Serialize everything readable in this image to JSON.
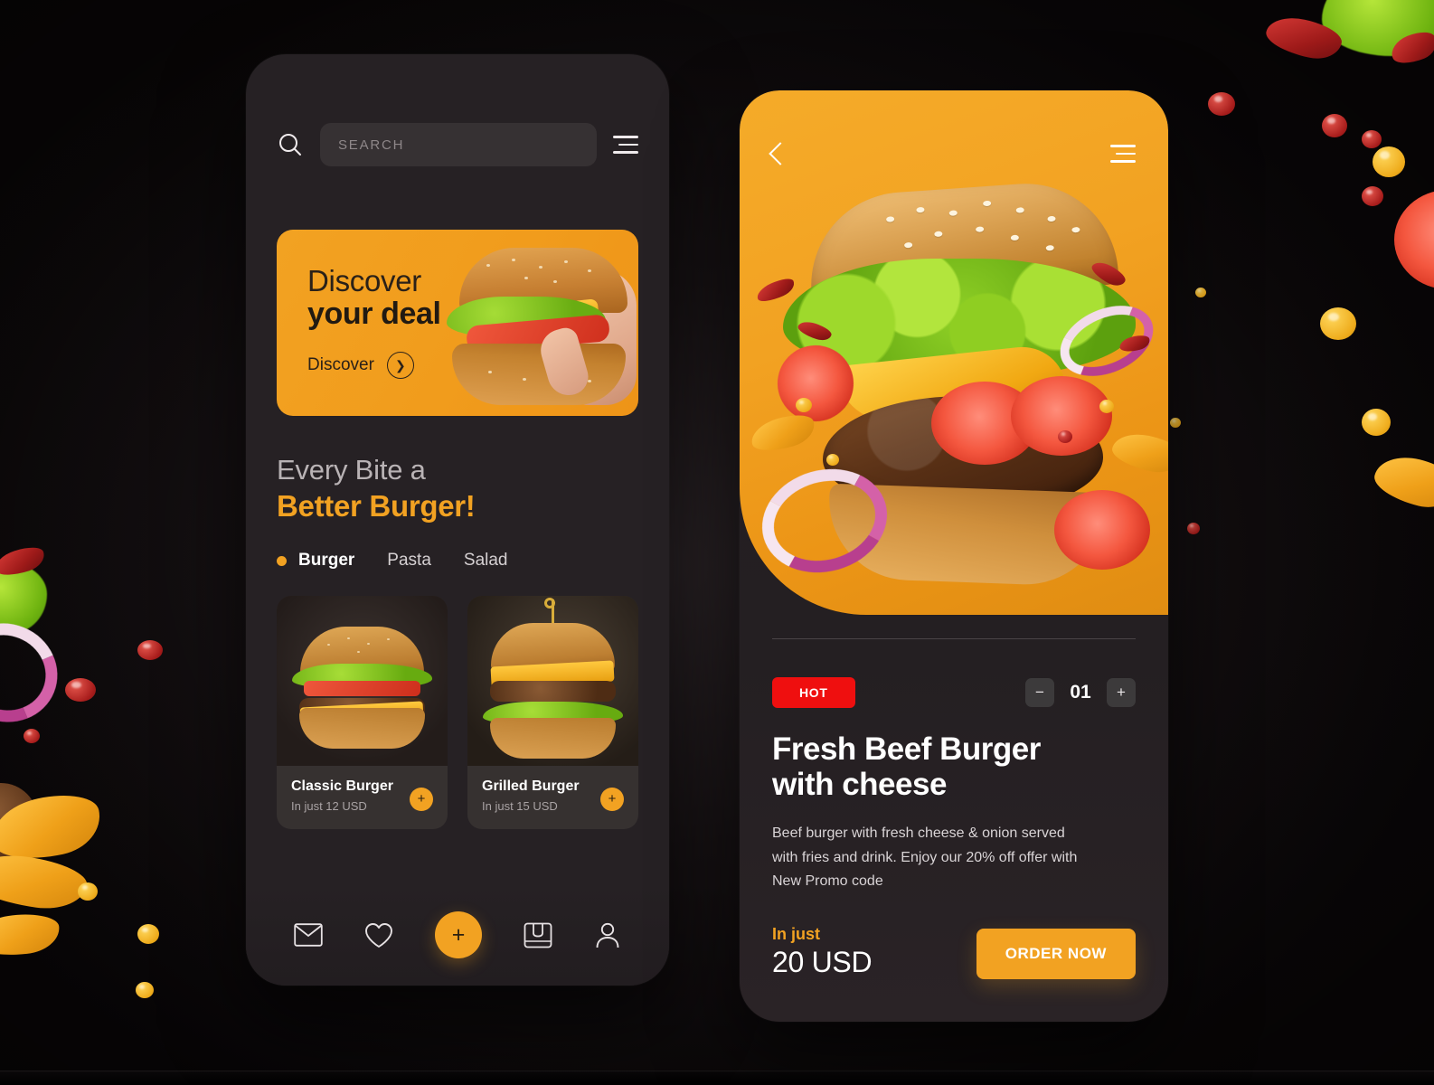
{
  "theme": {
    "accent": "#F2A222",
    "hot": "#EF0F0F",
    "phone_bg": "#262124",
    "card_bg": "#363130",
    "text_primary": "#FFFFFF",
    "text_muted": "#A9A3A4"
  },
  "home": {
    "search": {
      "placeholder": "SEARCH",
      "value": "",
      "icon": "search-icon"
    },
    "menu_icon": "hamburger-menu-icon",
    "promo": {
      "line1": "Discover",
      "line2": "your deal",
      "cta_label": "Discover",
      "cta_icon": "chevron-right-icon"
    },
    "section": {
      "line1": "Every Bite a",
      "line2": "Better Burger!"
    },
    "tabs": [
      {
        "label": "Burger",
        "active": true
      },
      {
        "label": "Pasta",
        "active": false
      },
      {
        "label": "Salad",
        "active": false
      }
    ],
    "products": [
      {
        "name": "Classic Burger",
        "price": "In just 12 USD",
        "add_label": "+"
      },
      {
        "name": "Grilled Burger",
        "price": "In just 15 USD",
        "add_label": "+"
      }
    ],
    "nav": [
      {
        "name": "mail-icon"
      },
      {
        "name": "heart-icon"
      },
      {
        "name": "add-icon",
        "label": "+"
      },
      {
        "name": "orders-box-icon"
      },
      {
        "name": "profile-person-icon"
      }
    ]
  },
  "detail": {
    "back_icon": "back-chevron-icon",
    "menu_icon": "hamburger-menu-icon",
    "badge": "HOT",
    "quantity": {
      "decrement": "−",
      "value": "01",
      "increment": "+"
    },
    "title_line1": "Fresh Beef Burger",
    "title_line2": "with cheese",
    "description": "Beef burger with fresh cheese & onion served with fries and drink. Enjoy our 20% off offer with New Promo code",
    "price_label": "In just",
    "price_value": "20 USD",
    "order_button": "ORDER NOW"
  }
}
